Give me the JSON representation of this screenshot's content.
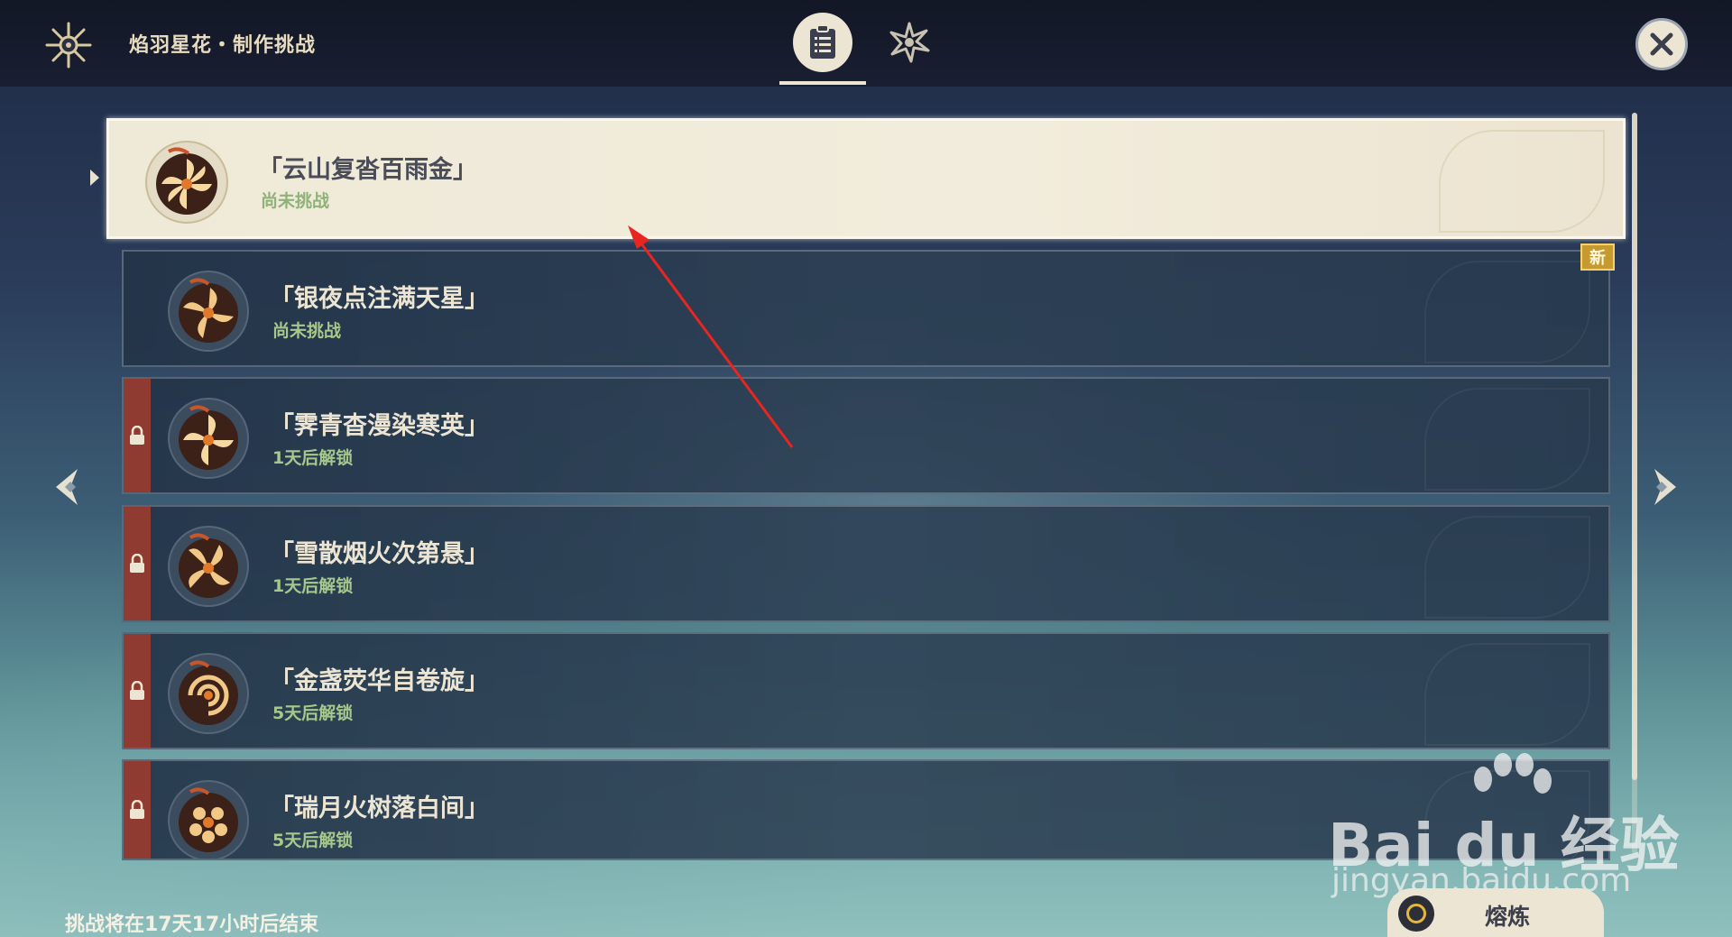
{
  "header": {
    "title": "焰羽星花・制作挑战",
    "tabs": [
      {
        "name": "challenge-list",
        "icon": "clipboard-list-icon",
        "active": true
      },
      {
        "name": "firework",
        "icon": "firework-icon",
        "active": false
      }
    ],
    "close_icon": "close-icon"
  },
  "challenges": [
    {
      "title": "「云山复沓百雨金」",
      "status": "尚未挑战",
      "locked": false,
      "selected": true
    },
    {
      "title": "「银夜点注满天星」",
      "status": "尚未挑战",
      "locked": false,
      "selected": false,
      "badge": "新"
    },
    {
      "title": "「霁青杳漫染寒英」",
      "status": "1天后解锁",
      "locked": true,
      "selected": false
    },
    {
      "title": "「雪散烟火次第悬」",
      "status": "1天后解锁",
      "locked": true,
      "selected": false
    },
    {
      "title": "「金盏荧华自卷旋」",
      "status": "5天后解锁",
      "locked": true,
      "selected": false
    },
    {
      "title": "「瑞月火树落白间」",
      "status": "5天后解锁",
      "locked": true,
      "selected": false
    }
  ],
  "footer": {
    "countdown": "挑战将在17天17小时后结束",
    "smelt_button": "熔炼"
  },
  "watermark": {
    "brand": "Bai du 经验",
    "url": "jingyan.baidu.com"
  },
  "colors": {
    "accent_cream": "#ece5d3",
    "status_green": "#a6c98b",
    "lock_red": "#8f3b31",
    "badge_gold": "#c79a2f",
    "annotation_red": "#e8251e"
  }
}
